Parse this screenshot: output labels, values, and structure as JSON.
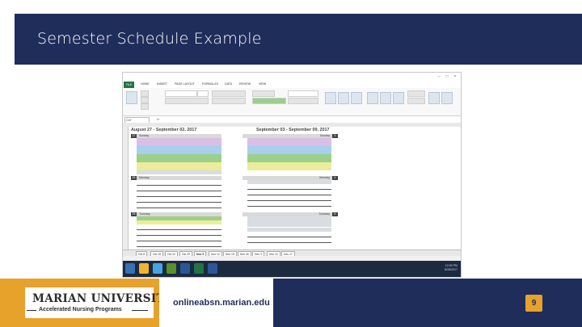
{
  "slide": {
    "title": "Semester Schedule Example",
    "footer_url": "onlineabsn.marian.edu",
    "page_number": "9"
  },
  "logo": {
    "name": "MARIAN UNIVERSITY",
    "subtitle": "Accelerated Nursing Programs"
  },
  "colors": {
    "navy": "#1f2d5a",
    "gold": "#e7a22b",
    "excel_green": "#217346",
    "event_purple": "#d8bfe6",
    "event_blue": "#a7d0ec",
    "event_green": "#9cd08a",
    "event_yellow": "#ecec9a",
    "event_grey": "#d9dde2"
  },
  "excel": {
    "file_tab": "FILE",
    "ribbon_tabs": [
      "HOME",
      "INSERT",
      "PAGE LAYOUT",
      "FORMULAS",
      "DATA",
      "REVIEW",
      "VIEW"
    ],
    "cell_ref": "C47",
    "fx": "fx",
    "week_left": {
      "title": "August 27 - September 02, 2017",
      "day_top_number": "27",
      "day_top_name": "Sunday",
      "day_mid_number": "28",
      "day_mid_name": "Monday",
      "day_bot_number": "29",
      "day_bot_name": "Tuesday"
    },
    "week_right": {
      "title": "September 03 - September 09, 2017",
      "day_top_number": "3",
      "day_top_name": "Sunday",
      "day_mid_number": "4",
      "day_mid_name": "Monday",
      "day_bot_number": "5",
      "day_bot_name": "Tuesday"
    },
    "sheet_tabs": [
      "Oct 8",
      "Oct 22",
      "Nov 5",
      "Nov 19",
      "Dec 3",
      "Dec 17",
      "Oct 15",
      "Oct 29",
      "Nov 12",
      "Nov 26",
      "Dec 10"
    ],
    "active_sheet_tab": "Nov 5",
    "clock_time": "12:00 PM",
    "clock_date": "8/26/2017"
  }
}
